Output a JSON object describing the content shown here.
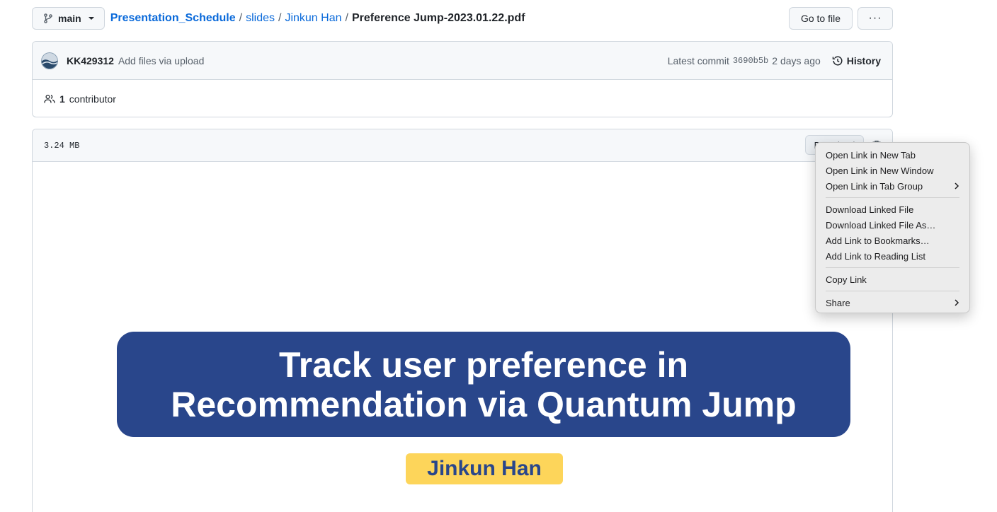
{
  "topbar": {
    "branch": "main",
    "breadcrumb": {
      "repo": "Presentation_Schedule",
      "sep": "/",
      "folder1": "slides",
      "folder2": "Jinkun Han",
      "file": "Preference Jump-2023.01.22.pdf"
    },
    "goto_label": "Go to file",
    "more_label": "···"
  },
  "commit": {
    "author": "KK429312",
    "message": "Add files via upload",
    "latest_label": "Latest commit",
    "sha": "3690b5b",
    "time": "2 days ago",
    "history_label": "History"
  },
  "contributors": {
    "count": "1",
    "label": "contributor"
  },
  "file": {
    "size": "3.24 MB",
    "download_label": "Download"
  },
  "slide": {
    "title_line1": "Track user preference in",
    "title_line2": "Recommendation via Quantum Jump",
    "author": "Jinkun Han",
    "colors": {
      "title_bg": "#29468b",
      "author_bg": "#fdd55a"
    }
  },
  "context_menu": {
    "items": [
      {
        "label": "Open Link in New Tab"
      },
      {
        "label": "Open Link in New Window"
      },
      {
        "label": "Open Link in Tab Group",
        "submenu": true
      },
      {
        "label": "Download Linked File"
      },
      {
        "label": "Download Linked File As…"
      },
      {
        "label": "Add Link to Bookmarks…"
      },
      {
        "label": "Add Link to Reading List"
      },
      {
        "label": "Copy Link"
      },
      {
        "label": "Share",
        "submenu": true
      }
    ]
  },
  "colors": {
    "link": "#0969da",
    "border": "#d0d7de",
    "header_bg": "#f6f8fa"
  }
}
